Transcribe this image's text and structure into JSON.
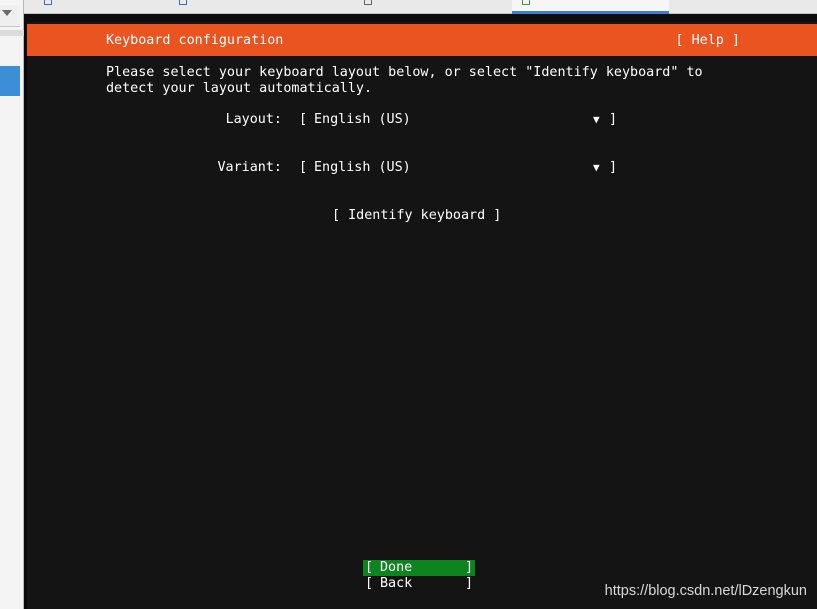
{
  "header": {
    "title": "Keyboard configuration",
    "help_label": "[ Help ]"
  },
  "intro_text": "Please select your keyboard layout below, or select \"Identify keyboard\" to\ndetect your layout automatically.",
  "layout_field": {
    "label": "Layout:",
    "value": "English (US)"
  },
  "variant_field": {
    "label": "Variant:",
    "value": "English (US)"
  },
  "identify_label": "[ Identify keyboard ]",
  "buttons": {
    "done_label": "Done",
    "back_label": "Back"
  },
  "watermark": "https://blog.csdn.net/lDzengkun",
  "colors": {
    "header_accent": "#e95420",
    "focused_button": "#0e8420",
    "screen_background": "#141414"
  }
}
